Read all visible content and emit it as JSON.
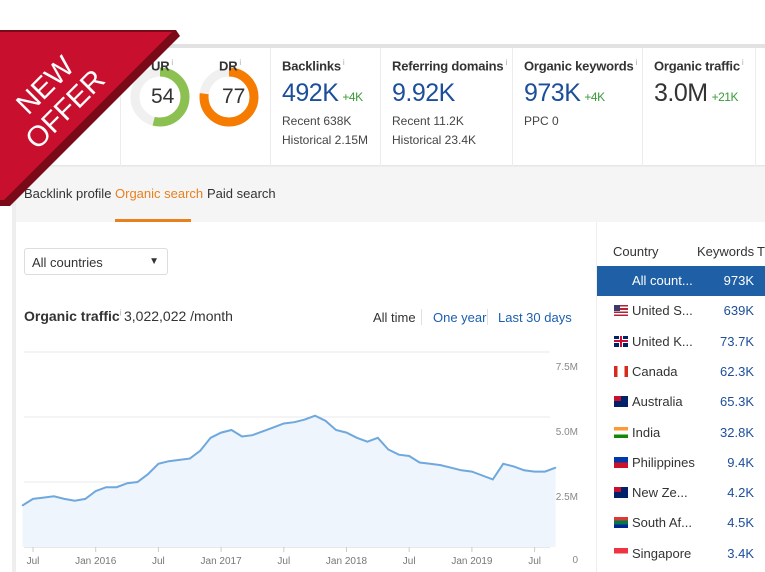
{
  "ribbon": {
    "text_line1": "NEW",
    "text_line2": "OFFER",
    "color": "#c8102e"
  },
  "metrics": {
    "ur": {
      "label": "UR",
      "info": "i",
      "value": "54",
      "percent": 54,
      "color": "#8cc152"
    },
    "dr": {
      "label": "DR",
      "info": "i",
      "value": "77",
      "percent": 77,
      "color": "#f57c00"
    },
    "backlinks": {
      "label": "Backlinks",
      "info": "i",
      "value": "492K",
      "delta": "+4K",
      "recent": "Recent 638K",
      "historical": "Historical 2.15M"
    },
    "referring_domains": {
      "label": "Referring domains",
      "info": "i",
      "value": "9.92K",
      "recent": "Recent 11.2K",
      "historical": "Historical 23.4K"
    },
    "organic_keywords": {
      "label": "Organic keywords",
      "info": "i",
      "value": "973K",
      "delta": "+4K",
      "ppc": "PPC 0"
    },
    "organic_traffic": {
      "label": "Organic traffic",
      "info": "i",
      "value": "3.0M",
      "delta": "+21K"
    }
  },
  "tabs": [
    {
      "label": "Backlink profile",
      "active": false
    },
    {
      "label": "Organic search",
      "active": true
    },
    {
      "label": "Paid search",
      "active": false
    }
  ],
  "filter": {
    "country_select": "All countries"
  },
  "traffic": {
    "title": "Organic traffic",
    "info": "i",
    "value": "3,022,022 /month",
    "ranges": [
      "All time",
      "One year",
      "Last 30 days"
    ],
    "active_range": "All time"
  },
  "countries": {
    "headers": [
      "Country",
      "Keywords",
      "Tr"
    ],
    "rows": [
      {
        "name": "All count...",
        "keywords": "973K",
        "flag": "none",
        "selected": true
      },
      {
        "name": "United S...",
        "keywords": "639K",
        "flag": "us"
      },
      {
        "name": "United K...",
        "keywords": "73.7K",
        "flag": "uk"
      },
      {
        "name": "Canada",
        "keywords": "62.3K",
        "flag": "ca"
      },
      {
        "name": "Australia",
        "keywords": "65.3K",
        "flag": "au"
      },
      {
        "name": "India",
        "keywords": "32.8K",
        "flag": "in"
      },
      {
        "name": "Philippines",
        "keywords": "9.4K",
        "flag": "ph"
      },
      {
        "name": "New Ze...",
        "keywords": "4.2K",
        "flag": "nz"
      },
      {
        "name": "South Af...",
        "keywords": "4.5K",
        "flag": "za"
      },
      {
        "name": "Singapore",
        "keywords": "3.4K",
        "flag": "sg"
      }
    ]
  },
  "chart_data": {
    "type": "area",
    "x_ticks": [
      "Jul",
      "Jan 2016",
      "Jul",
      "Jan 2017",
      "Jul",
      "Jan 2018",
      "Jul",
      "Jan 2019",
      "Jul"
    ],
    "x_tick_dates": [
      "2015-07",
      "2016-01",
      "2016-07",
      "2017-01",
      "2017-07",
      "2018-01",
      "2018-07",
      "2019-01",
      "2019-07"
    ],
    "y_ticks": [
      "0",
      "2.5M",
      "5.0M",
      "7.5M"
    ],
    "y_tick_values": [
      0,
      2500000,
      5000000,
      7500000
    ],
    "ylim": [
      0,
      7500000
    ],
    "y_axis_side": "right",
    "grid": true,
    "color": "#6fa8dc",
    "fill": "#eef5fc",
    "x": [
      "2015-06",
      "2015-07",
      "2015-08",
      "2015-09",
      "2015-10",
      "2015-11",
      "2015-12",
      "2016-01",
      "2016-02",
      "2016-03",
      "2016-04",
      "2016-05",
      "2016-06",
      "2016-07",
      "2016-08",
      "2016-09",
      "2016-10",
      "2016-11",
      "2016-12",
      "2017-01",
      "2017-02",
      "2017-03",
      "2017-04",
      "2017-05",
      "2017-06",
      "2017-07",
      "2017-08",
      "2017-09",
      "2017-10",
      "2017-11",
      "2017-12",
      "2018-01",
      "2018-02",
      "2018-03",
      "2018-04",
      "2018-05",
      "2018-06",
      "2018-07",
      "2018-08",
      "2018-09",
      "2018-10",
      "2018-11",
      "2018-12",
      "2019-01",
      "2019-02",
      "2019-03",
      "2019-04",
      "2019-05",
      "2019-06",
      "2019-07",
      "2019-08",
      "2019-09"
    ],
    "values": [
      1600000,
      1850000,
      1900000,
      1950000,
      1850000,
      1780000,
      1850000,
      2150000,
      2300000,
      2300000,
      2450000,
      2500000,
      2800000,
      3200000,
      3300000,
      3350000,
      3400000,
      3700000,
      4200000,
      4400000,
      4500000,
      4250000,
      4300000,
      4450000,
      4600000,
      4750000,
      4800000,
      4900000,
      5050000,
      4850000,
      4500000,
      4400000,
      4200000,
      4050000,
      4200000,
      3750000,
      3550000,
      3500000,
      3250000,
      3200000,
      3150000,
      3050000,
      2950000,
      2900000,
      2750000,
      2600000,
      3200000,
      3100000,
      2950000,
      2900000,
      2900000,
      3050000
    ]
  }
}
